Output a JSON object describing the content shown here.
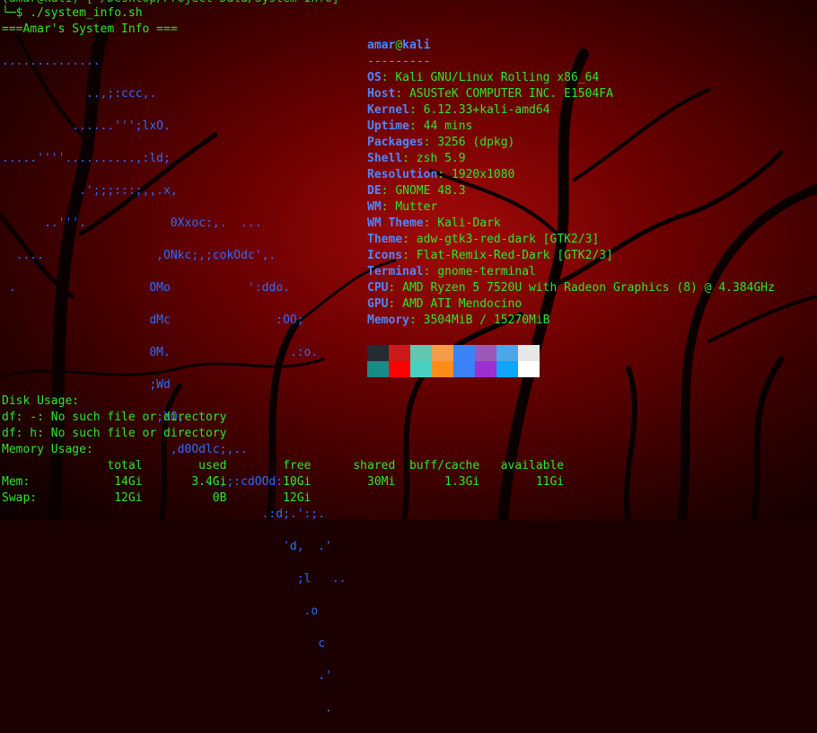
{
  "prompt": {
    "line": "└─$ ./system_info.sh",
    "top_partial": "(amar@kali)-[~/Desktop/Project Data/System Info]"
  },
  "header": "===Amar's System Info ===",
  "ascii_art": [
    "..............",
    "            ..,;:ccc,.",
    "          ......''';lxO.",
    ".....''''..........,:ld;",
    "           .';;;:::;,,.x,",
    "      ..'''.            0Xxoc:,.  ...",
    "  ....                ,ONkc;,;cokOdc',.",
    " .                   OMo           ':ddo.",
    "                     dMc               :OO;",
    "                     0M.                 .:o.",
    "                     ;Wd",
    "                      ;XO,",
    "                        ,d0Odlc;,..",
    "                            ..',;:cdOOd::,.",
    "                                     .:d;.':;.",
    "                                        'd,  .'",
    "                                          ;l   ..",
    "                                           .o",
    "                                             c",
    "                                             .'",
    "                                              ."
  ],
  "user_host": {
    "user": "amar",
    "at": "@",
    "host": "kali",
    "separator": "---------"
  },
  "info": [
    {
      "key": "OS",
      "value": "Kali GNU/Linux Rolling x86_64"
    },
    {
      "key": "Host",
      "value": "ASUSTeK COMPUTER INC. E1504FA"
    },
    {
      "key": "Kernel",
      "value": "6.12.33+kali-amd64"
    },
    {
      "key": "Uptime",
      "value": "44 mins"
    },
    {
      "key": "Packages",
      "value": "3256 (dpkg)"
    },
    {
      "key": "Shell",
      "value": "zsh 5.9"
    },
    {
      "key": "Resolution",
      "value": "1920x1080"
    },
    {
      "key": "DE",
      "value": "GNOME 48.3"
    },
    {
      "key": "WM",
      "value": "Mutter"
    },
    {
      "key": "WM Theme",
      "value": "Kali-Dark"
    },
    {
      "key": "Theme",
      "value": "adw-gtk3-red-dark [GTK2/3]"
    },
    {
      "key": "Icons",
      "value": "Flat-Remix-Red-Dark [GTK2/3]"
    },
    {
      "key": "Terminal",
      "value": "gnome-terminal"
    },
    {
      "key": "CPU",
      "value": "AMD Ryzen 5 7520U with Radeon Graphics (8) @ 4.384GHz"
    },
    {
      "key": "GPU",
      "value": "AMD ATI Mendocino"
    },
    {
      "key": "Memory",
      "value": "3504MiB / 15270MiB"
    }
  ],
  "palette_top": [
    "#262a33",
    "#cc1a1a",
    "#5fc7b2",
    "#f39c4a",
    "#3b82f6",
    "#9b59b6",
    "#4aa8e8",
    "#e8e8e8"
  ],
  "palette_bottom": [
    "#1a8a86",
    "#ff0000",
    "#48d1c1",
    "#ff8c1a",
    "#3b82f6",
    "#9b2fd0",
    "#0ea5ff",
    "#ffffff"
  ],
  "disk": {
    "title": "Disk Usage:",
    "lines": [
      "df: -: No such file or directory",
      "df: h: No such file or directory"
    ]
  },
  "memory": {
    "title": "Memory Usage:",
    "header": "               total        used        free      shared  buff/cache   available",
    "rows": [
      "Mem:            14Gi       3.4Gi        10Gi        30Mi       1.3Gi        11Gi",
      "Swap:           12Gi          0B        12Gi"
    ]
  }
}
